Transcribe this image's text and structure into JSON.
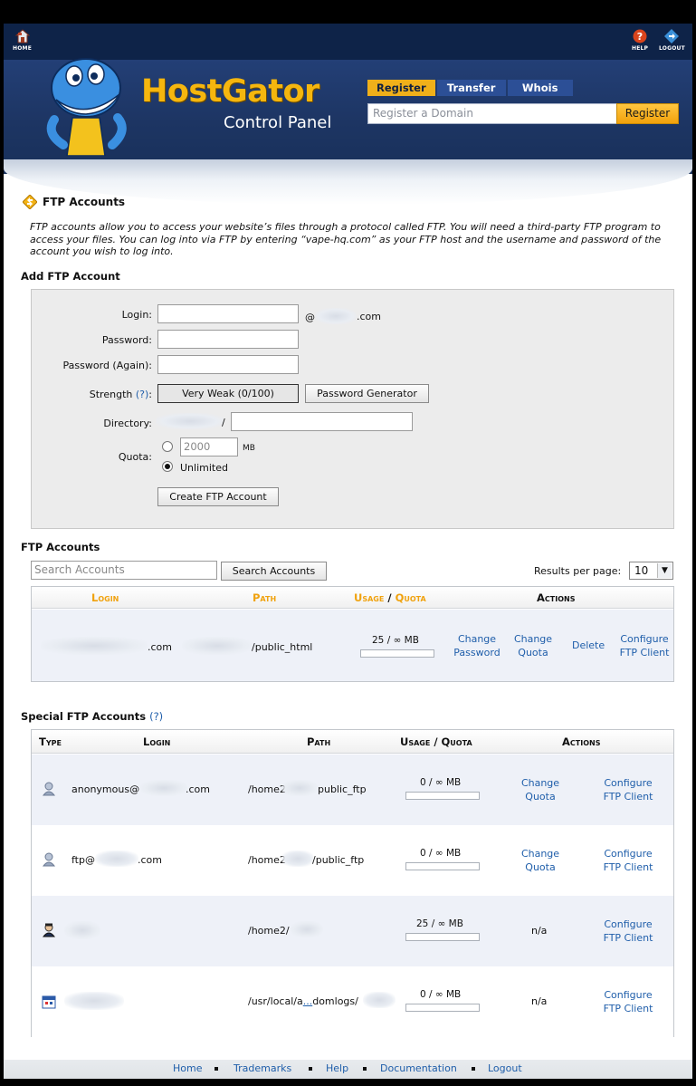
{
  "header": {
    "home_label": "HOME",
    "help_label": "HELP",
    "logout_label": "LOGOUT",
    "logo_text": "HostGator",
    "subtitle": "Control Panel",
    "tabs": [
      {
        "label": "Register",
        "active": true
      },
      {
        "label": "Transfer",
        "active": false
      },
      {
        "label": "Whois",
        "active": false
      }
    ],
    "domain_placeholder": "Register a Domain",
    "register_button": "Register",
    "accent_color": "#f5b60e",
    "header_color": "#1d3563"
  },
  "page": {
    "title": "FTP Accounts",
    "description": "FTP accounts allow you to access your website’s files through a protocol called FTP. You will need a third-party FTP program to access your files. You can log into via FTP by entering “vape-hq.com” as your FTP host and the username and password of the account you wish to log into."
  },
  "add_form": {
    "section_title": "Add FTP Account",
    "login_label": "Login:",
    "login_value": "",
    "at_sign": "@",
    "domain_suffix": ".com",
    "password_label": "Password:",
    "password_again_label": "Password (Again):",
    "strength_label": "Strength",
    "strength_help": "(?)",
    "strength_colon": ":",
    "strength_value": "Very Weak (0/100)",
    "password_generator": "Password Generator",
    "directory_label": "Directory:",
    "directory_slash": "/",
    "quota_label": "Quota:",
    "quota_value": "2000",
    "quota_unit": "MB",
    "unlimited_label": "Unlimited",
    "create_button": "Create FTP Account"
  },
  "ftp_accounts": {
    "section_title": "FTP Accounts",
    "search_placeholder": "Search Accounts",
    "search_button": "Search Accounts",
    "results_label": "Results per page:",
    "results_value": "10",
    "columns": {
      "login": "Login",
      "path": "Path",
      "usage": "Usage",
      "slash": "/",
      "quota": "Quota",
      "actions": "Actions"
    },
    "rows": [
      {
        "login_suffix": ".com",
        "path_suffix": "/public_html",
        "usage": "25 / ∞ MB",
        "usage_fraction": 0,
        "change_password": "Change Password",
        "change_quota": "Change Quota",
        "delete": "Delete",
        "configure": "Configure FTP Client"
      }
    ]
  },
  "special_accounts": {
    "section_title": "Special FTP Accounts",
    "help": "(?)",
    "columns": {
      "type": "Type",
      "login": "Login",
      "path": "Path",
      "usage_quota": "Usage / Quota",
      "actions": "Actions"
    },
    "rows": [
      {
        "icon": "user-icon",
        "login_prefix": "anonymous@",
        "login_suffix": ".com",
        "path_prefix": "/home2",
        "path_suffix": "public_ftp",
        "usage": "0 / ∞ MB",
        "action1": "Change Quota",
        "action2": "Configure FTP Client"
      },
      {
        "icon": "user-icon",
        "login_prefix": "ftp@",
        "login_suffix": ".com",
        "path_prefix": "/home2",
        "path_suffix": "/public_ftp",
        "usage": "0 / ∞ MB",
        "action1": "Change Quota",
        "action2": "Configure FTP Client"
      },
      {
        "icon": "admin-user-icon",
        "login_prefix": "",
        "login_suffix": "",
        "path_prefix": "/home2/",
        "path_suffix": "",
        "usage": "25 / ∞ MB",
        "action1": "n/a",
        "action2": "Configure FTP Client"
      },
      {
        "icon": "calendar-log-icon",
        "login_prefix": "",
        "login_suffix": "",
        "path_prefix": "/usr/local/a",
        "path_link": "...",
        "path_suffix": "domlogs/",
        "usage": "0 / ∞ MB",
        "action1": "n/a",
        "action2": "Configure FTP Client"
      }
    ]
  },
  "footer": {
    "links": [
      "Home",
      "Trademarks",
      "Help",
      "Documentation",
      "Logout"
    ]
  }
}
